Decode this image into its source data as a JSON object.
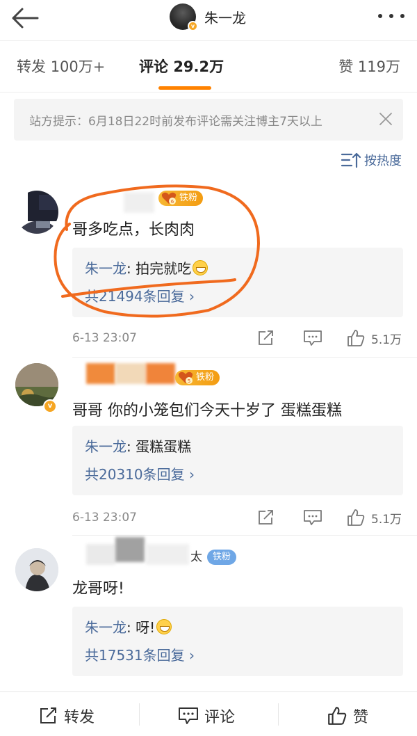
{
  "header": {
    "back_icon": "arrow-left-icon",
    "username": "朱一龙",
    "verified_badge": "v",
    "more_icon": "more-dots-icon"
  },
  "tabs": [
    {
      "label": "转发",
      "count": "100万+"
    },
    {
      "label": "评论",
      "count": "29.2万",
      "active": true
    },
    {
      "label": "赞",
      "count": "119万"
    }
  ],
  "notice": {
    "text": "站方提示：6月18日22时前发布评论需关注博主7天以上",
    "close_icon": "close-icon"
  },
  "sort": {
    "label": "按热度",
    "icon": "sort-icon"
  },
  "comments": [
    {
      "fan_label": "铁粉",
      "fan_level": "6",
      "text": "哥多吃点，长肉肉",
      "reply_author": "朱一龙",
      "reply_sep": ": ",
      "reply_content": "拍完就吃",
      "reply_total": "共21494条回复 ›",
      "date": "6-13 23:07",
      "likes": "5.1万"
    },
    {
      "fan_label": "铁粉",
      "fan_level": "5",
      "text": "哥哥 你的小笼包们今天十岁了 蛋糕蛋糕",
      "reply_author": "朱一龙",
      "reply_sep": ": ",
      "reply_content": "蛋糕蛋糕",
      "reply_total": "共20310条回复 ›",
      "date": "6-13 23:07",
      "likes": "5.1万"
    },
    {
      "fan_label": "铁粉",
      "name_tail": "太",
      "text": "龙哥呀!",
      "reply_author": "朱一龙",
      "reply_sep": ": ",
      "reply_content": "呀!",
      "reply_total": "共17531条回复 ›"
    }
  ],
  "bottom_bar": [
    {
      "label": "转发",
      "icon": "share-icon"
    },
    {
      "label": "评论",
      "icon": "comment-icon"
    },
    {
      "label": "赞",
      "icon": "thumb-up-icon"
    }
  ],
  "colors": {
    "accent": "#ff8200",
    "link": "#4a6a9a",
    "annotation": "#f06a1e"
  }
}
